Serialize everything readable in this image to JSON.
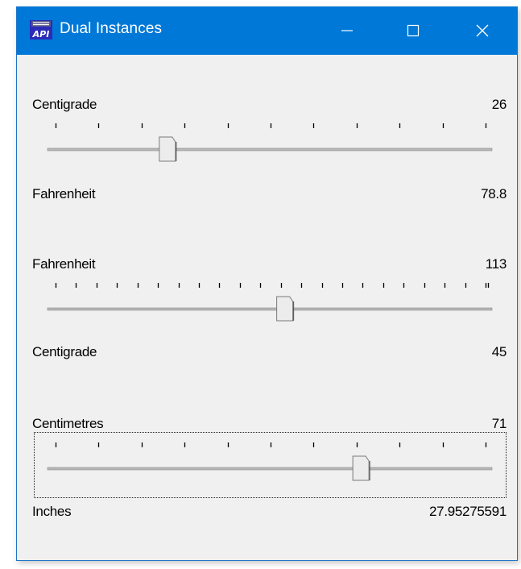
{
  "window": {
    "title": "Dual Instances",
    "app_icon_text": "API"
  },
  "colors": {
    "titlebar": "#0078d7",
    "client": "#f0f0f0",
    "track": "#b8b8b8",
    "thumb": "#ececec"
  },
  "titlebar_buttons": [
    "minimize-icon",
    "maximize-icon",
    "close-icon"
  ],
  "converters": [
    {
      "from_label": "Centigrade",
      "from_value": "26",
      "to_label": "Fahrenheit",
      "to_value": "78.8",
      "slider": {
        "min": 0,
        "max": 100,
        "value": 26,
        "tick_count": 11
      }
    },
    {
      "from_label": "Fahrenheit",
      "from_value": "113",
      "to_label": "Centigrade",
      "to_value": "45",
      "slider": {
        "min": 0,
        "max": 212,
        "value": 113,
        "tick_count": 22
      }
    },
    {
      "from_label": "Centimetres",
      "from_value": "71",
      "to_label": "Inches",
      "to_value": "27.95275591",
      "slider": {
        "min": 0,
        "max": 100,
        "value": 71,
        "tick_count": 11
      }
    }
  ]
}
